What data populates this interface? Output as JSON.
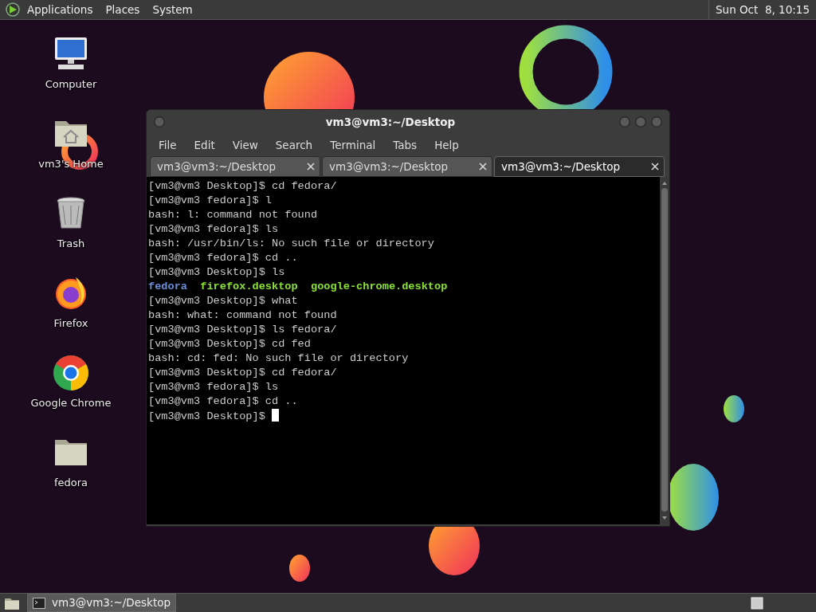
{
  "top_panel": {
    "menus": [
      "Applications",
      "Places",
      "System"
    ],
    "clock": "Sun Oct  8, 10:15"
  },
  "desktop_icons": [
    {
      "label": "Computer",
      "kind": "computer"
    },
    {
      "label": "vm3's Home",
      "kind": "home"
    },
    {
      "label": "Trash",
      "kind": "trash"
    },
    {
      "label": "Firefox",
      "kind": "firefox"
    },
    {
      "label": "Google Chrome",
      "kind": "chrome"
    },
    {
      "label": "fedora",
      "kind": "folder"
    }
  ],
  "terminal": {
    "title": "vm3@vm3:~/Desktop",
    "menus": [
      "File",
      "Edit",
      "View",
      "Search",
      "Terminal",
      "Tabs",
      "Help"
    ],
    "tabs": [
      {
        "label": "vm3@vm3:~/Desktop",
        "selected": false
      },
      {
        "label": "vm3@vm3:~/Desktop",
        "selected": false
      },
      {
        "label": "vm3@vm3:~/Desktop",
        "selected": true
      }
    ],
    "lines": [
      {
        "kind": "text",
        "text": "[vm3@vm3 Desktop]$ cd fedora/"
      },
      {
        "kind": "text",
        "text": "[vm3@vm3 fedora]$ l"
      },
      {
        "kind": "text",
        "text": "bash: l: command not found"
      },
      {
        "kind": "text",
        "text": "[vm3@vm3 fedora]$ ls"
      },
      {
        "kind": "text",
        "text": "bash: /usr/bin/ls: No such file or directory"
      },
      {
        "kind": "text",
        "text": "[vm3@vm3 fedora]$ cd .."
      },
      {
        "kind": "text",
        "text": "[vm3@vm3 Desktop]$ ls"
      },
      {
        "kind": "listing",
        "entries": [
          {
            "name": "fedora",
            "color": "#6b8fd8"
          },
          {
            "name": "firefox.desktop",
            "color": "#8ae234"
          },
          {
            "name": "google-chrome.desktop",
            "color": "#8ae234"
          }
        ]
      },
      {
        "kind": "text",
        "text": "[vm3@vm3 Desktop]$ what"
      },
      {
        "kind": "text",
        "text": "bash: what: command not found"
      },
      {
        "kind": "text",
        "text": "[vm3@vm3 Desktop]$ ls fedora/"
      },
      {
        "kind": "text",
        "text": "[vm3@vm3 Desktop]$ cd fed"
      },
      {
        "kind": "text",
        "text": "bash: cd: fed: No such file or directory"
      },
      {
        "kind": "text",
        "text": "[vm3@vm3 Desktop]$ cd fedora/"
      },
      {
        "kind": "text",
        "text": "[vm3@vm3 fedora]$ ls"
      },
      {
        "kind": "text",
        "text": "[vm3@vm3 fedora]$ cd .."
      },
      {
        "kind": "text",
        "text": "[vm3@vm3 Desktop]$ "
      }
    ],
    "cursor_visible": true
  },
  "taskbar": {
    "tasks": [
      {
        "label": "vm3@vm3:~/Desktop",
        "selected": true
      }
    ]
  }
}
